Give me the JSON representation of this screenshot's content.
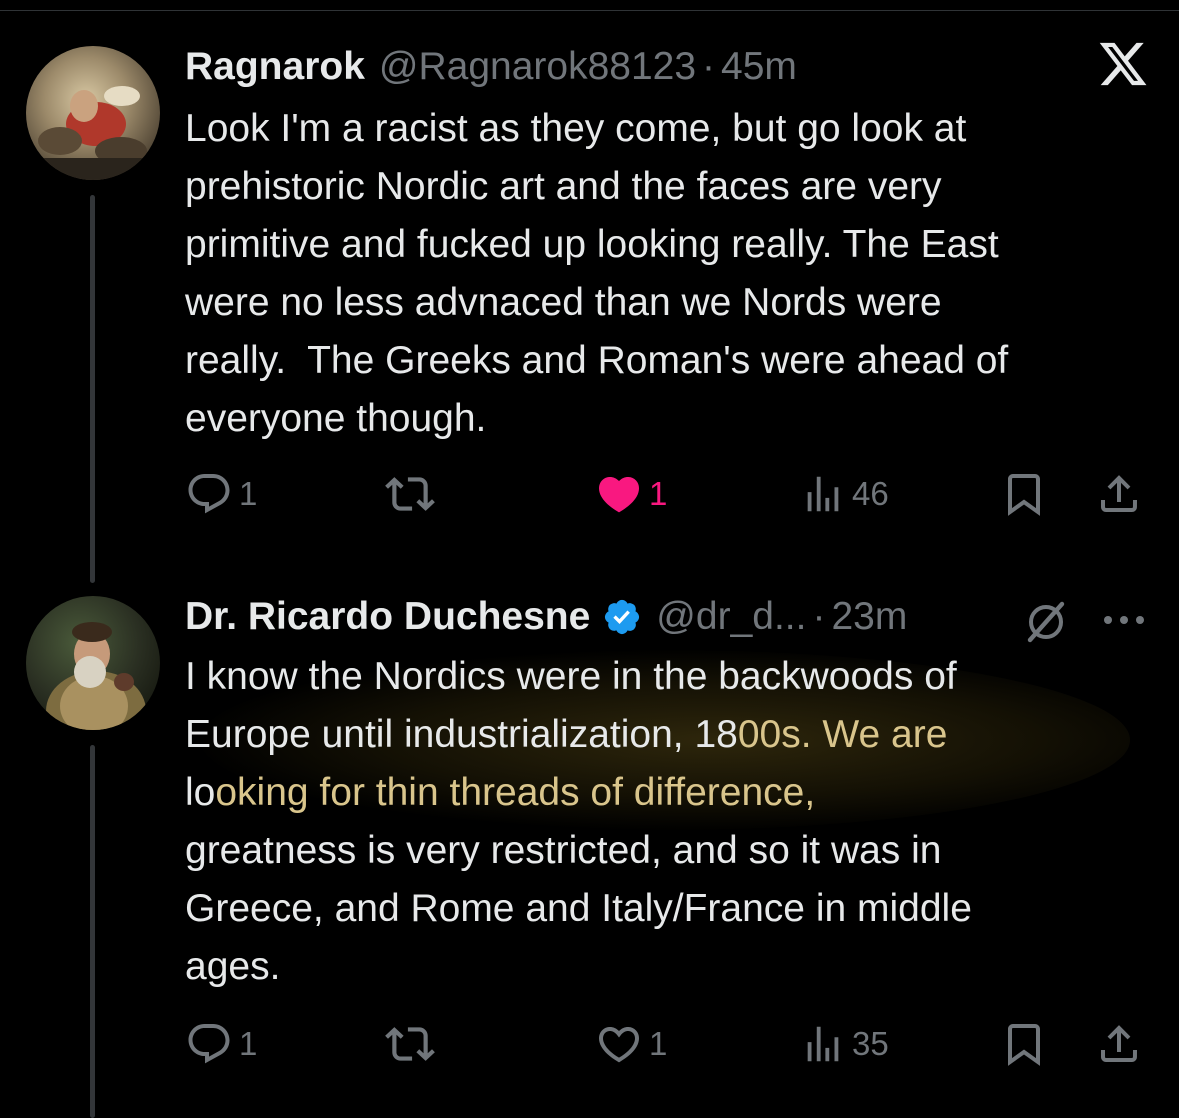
{
  "tweets": [
    {
      "name": "Ragnarok",
      "handle": "@Ragnarok88123",
      "separator": "·",
      "time": "45m",
      "lines": [
        "Look I'm a racist as they come, but go look at",
        "prehistoric Nordic art and the faces are very",
        "primitive and fucked up looking really. The East",
        "were no less advnaced than we Nords were",
        "really.  The Greeks and Roman's were ahead of",
        "everyone though."
      ],
      "replies": "1",
      "retweets": "",
      "likes": "1",
      "liked": true,
      "views": "46"
    },
    {
      "name": "Dr. Ricardo Duchesne",
      "handle": "@dr_d...",
      "separator": "·",
      "time": "23m",
      "line1": "I know the Nordics were in the backwoods of",
      "line2_plain": "Europe until industrialization, 18",
      "line2_hl": "00s. We are",
      "line3_plain": "lo",
      "line3_hl": "oking for thin threads of difference,",
      "line4": "greatness is very restricted, and so it was in",
      "line5": "Greece, and Rome and Italy/France in middle",
      "line6": "ages.",
      "replies": "1",
      "retweets": "",
      "likes": "1",
      "liked": false,
      "views": "35"
    }
  ],
  "colors": {
    "background": "#000000",
    "text": "#e7e9ea",
    "muted": "#71767b",
    "like_active": "#f91880",
    "verified": "#1d9bf0",
    "highlight_text": "#d9c58c"
  },
  "icons": [
    "x-logo-icon",
    "reply-icon",
    "retweet-icon",
    "heart-icon",
    "views-icon",
    "bookmark-icon",
    "share-icon",
    "verified-badge-icon",
    "grok-icon",
    "more-icon"
  ]
}
